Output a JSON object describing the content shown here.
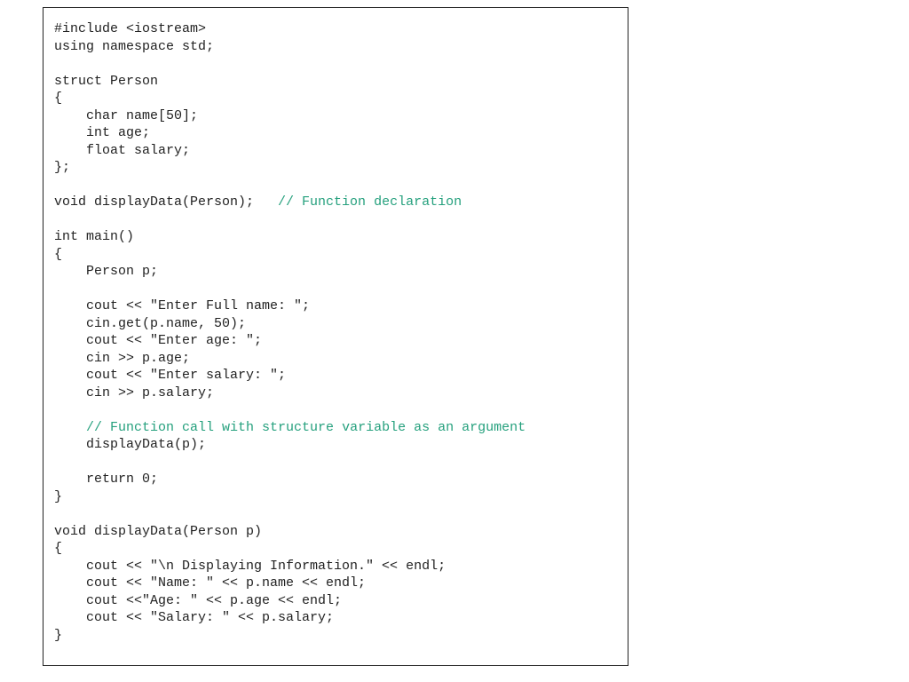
{
  "code": {
    "l01": "#include <iostream>",
    "l02": "using namespace std;",
    "l03": "",
    "l04": "struct Person",
    "l05": "{",
    "l06": "    char name[50];",
    "l07": "    int age;",
    "l08": "    float salary;",
    "l09": "};",
    "l10": "",
    "l11a": "void displayData(Person);   ",
    "l11b": "// Function declaration",
    "l12": "",
    "l13": "int main()",
    "l14": "{",
    "l15": "    Person p;",
    "l16": "",
    "l17": "    cout << \"Enter Full name: \";",
    "l18": "    cin.get(p.name, 50);",
    "l19": "    cout << \"Enter age: \";",
    "l20": "    cin >> p.age;",
    "l21": "    cout << \"Enter salary: \";",
    "l22": "    cin >> p.salary;",
    "l23": "",
    "l24a": "    ",
    "l24b": "// Function call with structure variable as an argument",
    "l25": "    displayData(p);",
    "l26": "",
    "l27": "    return 0;",
    "l28": "}",
    "l29": "",
    "l30": "void displayData(Person p)",
    "l31": "{",
    "l32": "    cout << \"\\n Displaying Information.\" << endl;",
    "l33": "    cout << \"Name: \" << p.name << endl;",
    "l34": "    cout <<\"Age: \" << p.age << endl;",
    "l35": "    cout << \"Salary: \" << p.salary;",
    "l36": "}"
  }
}
